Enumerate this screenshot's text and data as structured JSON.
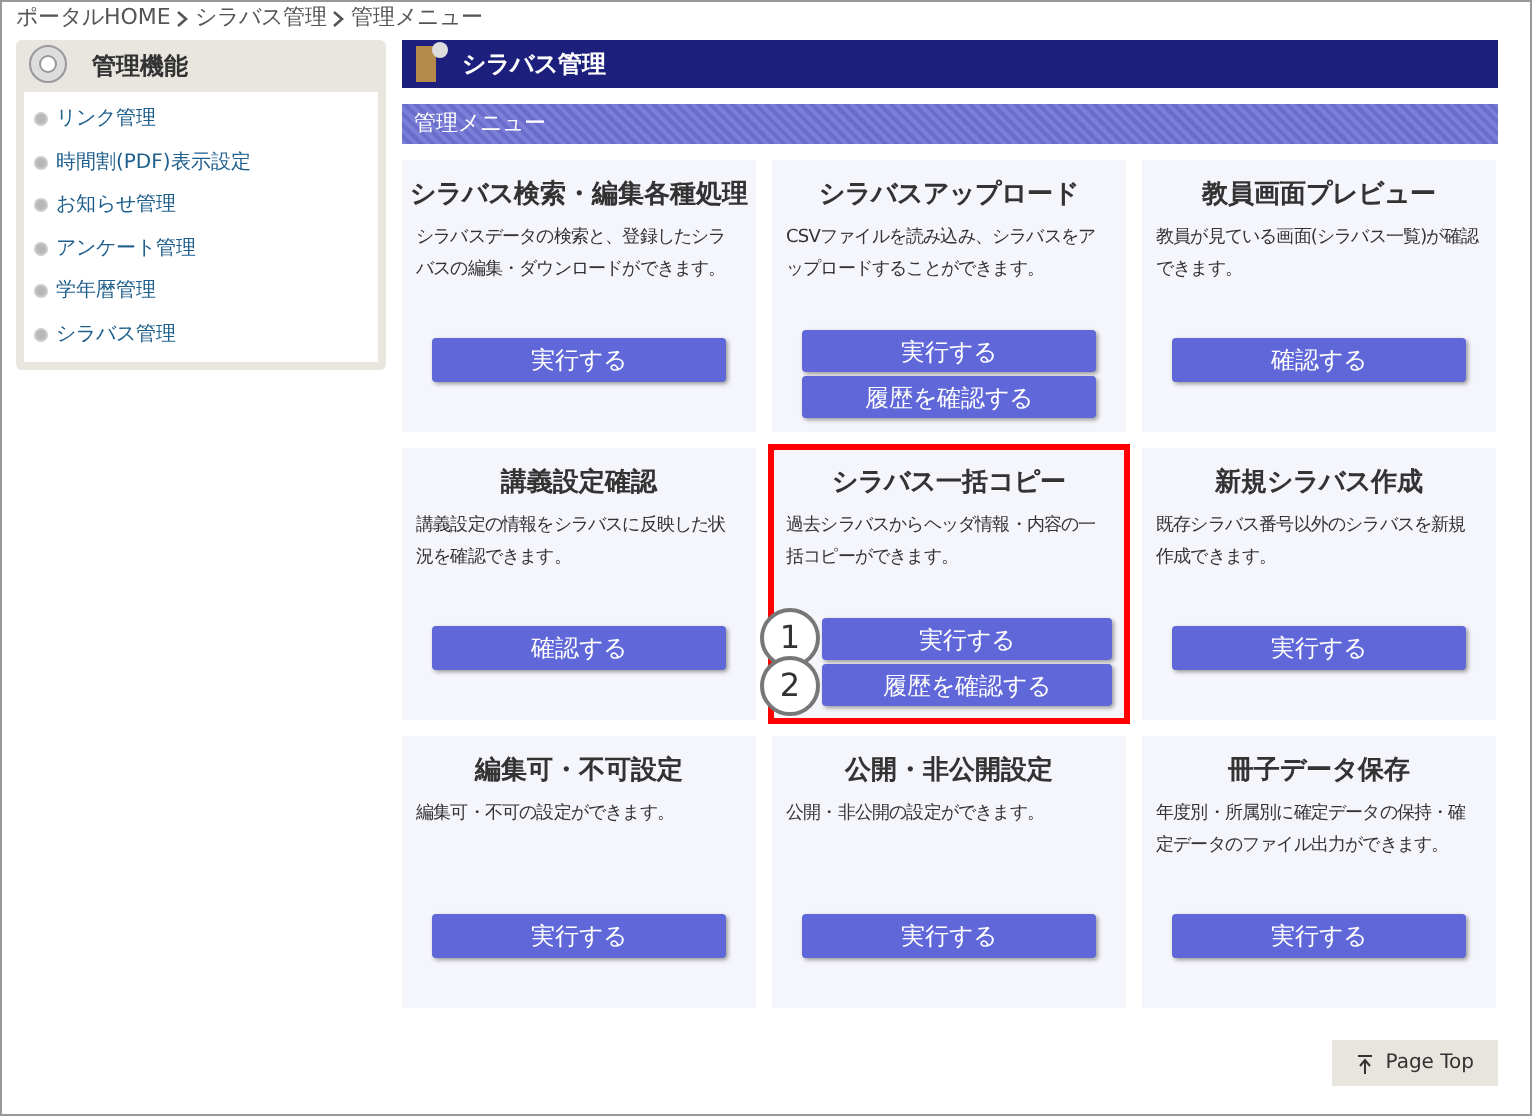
{
  "breadcrumb": [
    "ポータルHOME",
    "シラバス管理",
    "管理メニュー"
  ],
  "sidebar": {
    "title": "管理機能",
    "items": [
      "リンク管理",
      "時間割(PDF)表示設定",
      "お知らせ管理",
      "アンケート管理",
      "学年暦管理",
      "シラバス管理"
    ]
  },
  "section_title": "シラバス管理",
  "subsection_title": "管理メニュー",
  "cards": [
    {
      "title": "シラバス検索・編集各種処理",
      "description": "シラバスデータの検索と、登録したシラバスの編集・ダウンロードができます。",
      "highlighted": false,
      "buttons": [
        {
          "label": "実行する"
        }
      ]
    },
    {
      "title": "シラバスアップロード",
      "description": "CSVファイルを読み込み、シラバスをアップロードすることができます。",
      "highlighted": false,
      "buttons": [
        {
          "label": "実行する"
        },
        {
          "label": "履歴を確認する"
        }
      ]
    },
    {
      "title": "教員画面プレビュー",
      "description": "教員が見ている画面(シラバス一覧)が確認できます。",
      "highlighted": false,
      "buttons": [
        {
          "label": "確認する"
        }
      ]
    },
    {
      "title": "講義設定確認",
      "description": "講義設定の情報をシラバスに反映した状況を確認できます。",
      "highlighted": false,
      "buttons": [
        {
          "label": "確認する"
        }
      ]
    },
    {
      "title": "シラバス一括コピー",
      "description": "過去シラバスからヘッダ情報・内容の一括コピーができます。",
      "highlighted": true,
      "buttons": [
        {
          "label": "実行する",
          "callout": "1"
        },
        {
          "label": "履歴を確認する",
          "callout": "2"
        }
      ]
    },
    {
      "title": "新規シラバス作成",
      "description": "既存シラバス番号以外のシラバスを新規作成できます。",
      "highlighted": false,
      "buttons": [
        {
          "label": "実行する"
        }
      ]
    },
    {
      "title": "編集可・不可設定",
      "description": "編集可・不可の設定ができます。",
      "highlighted": false,
      "buttons": [
        {
          "label": "実行する"
        }
      ]
    },
    {
      "title": "公開・非公開設定",
      "description": "公開・非公開の設定ができます。",
      "highlighted": false,
      "buttons": [
        {
          "label": "実行する"
        }
      ]
    },
    {
      "title": "冊子データ保存",
      "description": "年度別・所属別に確定データの保持・確定データのファイル出力ができます。",
      "highlighted": false,
      "buttons": [
        {
          "label": "実行する"
        }
      ]
    }
  ],
  "page_top": "Page Top"
}
